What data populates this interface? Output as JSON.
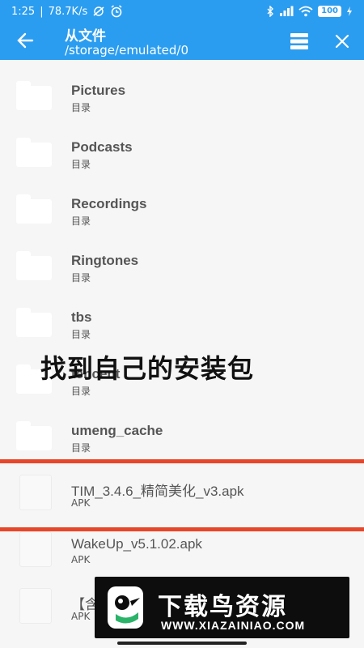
{
  "statusbar": {
    "time": "1:25",
    "speed": "78.7K/s",
    "battery": "100"
  },
  "appbar": {
    "title": "从文件",
    "path": "/storage/emulated/0"
  },
  "items": [
    {
      "name": "Pictures",
      "meta": "目录",
      "kind": "folder"
    },
    {
      "name": "Podcasts",
      "meta": "目录",
      "kind": "folder"
    },
    {
      "name": "Recordings",
      "meta": "目录",
      "kind": "folder"
    },
    {
      "name": "Ringtones",
      "meta": "目录",
      "kind": "folder"
    },
    {
      "name": "tbs",
      "meta": "目录",
      "kind": "folder"
    },
    {
      "name": "tencent",
      "meta": "目录",
      "kind": "folder"
    },
    {
      "name": "umeng_cache",
      "meta": "目录",
      "kind": "folder"
    },
    {
      "name": "TIM_3.4.6_精简美化_v3.apk",
      "meta": "APK",
      "kind": "file"
    },
    {
      "name": "WakeUp_v5.1.02.apk",
      "meta": "APK",
      "kind": "file"
    },
    {
      "name": "【含",
      "meta": "APK",
      "kind": "file"
    }
  ],
  "overlay": {
    "caption": "找到自己的安装包"
  },
  "banner": {
    "title": "下载鸟资源",
    "url": "WWW.XIAZAINIAO.COM"
  },
  "colors": {
    "primary": "#2b9df0",
    "highlight": "#e8462a"
  }
}
